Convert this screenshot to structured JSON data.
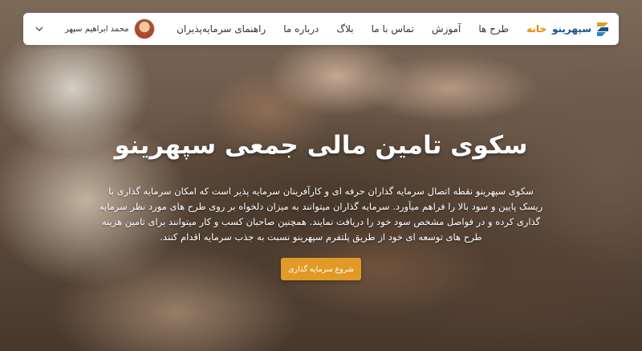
{
  "nav": {
    "logo_text": "سپهرینو",
    "items": [
      {
        "label": "خانه",
        "active": true
      },
      {
        "label": "طرح ها",
        "active": false
      },
      {
        "label": "آموزش",
        "active": false
      },
      {
        "label": "تماس با ما",
        "active": false
      },
      {
        "label": "بلاگ",
        "active": false
      },
      {
        "label": "درباره ما",
        "active": false
      },
      {
        "label": "راهنمای سرمایه‌پذیران",
        "active": false
      }
    ],
    "user_name": "محمد ابراهیم سپهر"
  },
  "hero": {
    "title": "سکوی تامین مالی جمعی سپهرینو",
    "description": "سکوی سپهرینو نقطه اتصال سرمایه گذاران حرفه ای و کارآفرینان سرمایه پذیر است که امکان سرمایه گذاری با ریسک پایین و سود بالا را فراهم میآورد. سرمایه گذاران میتوانند به میزان دلخواه بر روی طرح های مورد نظر سرمایه گذاری کرده و در فواصل مشخص سود خود را دریافت نمایند. همچنین صاحبان کسب و کار میتوانند برای تامین هزینه طرح های توسعه ای خود از طریق پلتفرم سپهرینو نسبت به جذب سرمایه اقدام کنند.",
    "cta_label": "شروع سرمایه گذاری"
  },
  "colors": {
    "accent": "#e09a25",
    "active_menu": "#e08a00",
    "brand": "#1b4f8f"
  }
}
